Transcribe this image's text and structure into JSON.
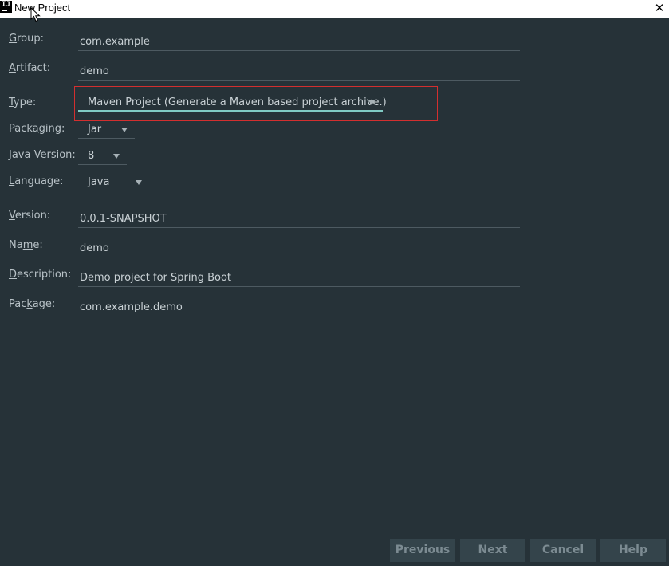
{
  "window": {
    "title": "New Project",
    "app_icon_text": "IJ",
    "close_glyph": "✕"
  },
  "form": {
    "group": {
      "label_pre": "",
      "label_mn": "G",
      "label_post": "roup:",
      "value": "com.example"
    },
    "artifact": {
      "label_pre": "",
      "label_mn": "A",
      "label_post": "rtifact:",
      "value": "demo"
    },
    "type": {
      "label_pre": "",
      "label_mn": "T",
      "label_post": "ype:",
      "value": "Maven Project (Generate a Maven based project archive.)"
    },
    "packaging": {
      "label_pre": "Packa",
      "label_mn": "g",
      "label_post": "ing:",
      "value": "Jar"
    },
    "java_version": {
      "label_pre": "",
      "label_mn": "J",
      "label_post": "ava Version:",
      "value": "8"
    },
    "language": {
      "label_pre": "",
      "label_mn": "L",
      "label_post": "anguage:",
      "value": "Java"
    },
    "version": {
      "label_pre": "",
      "label_mn": "V",
      "label_post": "ersion:",
      "value": "0.0.1-SNAPSHOT"
    },
    "name": {
      "label_pre": "Na",
      "label_mn": "m",
      "label_post": "e:",
      "value": "demo"
    },
    "description": {
      "label_pre": "",
      "label_mn": "D",
      "label_post": "escription:",
      "value": "Demo project for Spring Boot"
    },
    "package": {
      "label_pre": "Pac",
      "label_mn": "k",
      "label_post": "age:",
      "value": "com.example.demo"
    }
  },
  "buttons": {
    "previous": "Previous",
    "next": "Next",
    "cancel": "Cancel",
    "help": "Help"
  },
  "colors": {
    "background": "#263238",
    "label": "#b8c2c7",
    "value": "#c9d1d5",
    "focus_underline": "#80cbc4",
    "highlight_box": "#d32f2f",
    "button_bg": "#34444b",
    "button_text": "#7c8b92"
  }
}
